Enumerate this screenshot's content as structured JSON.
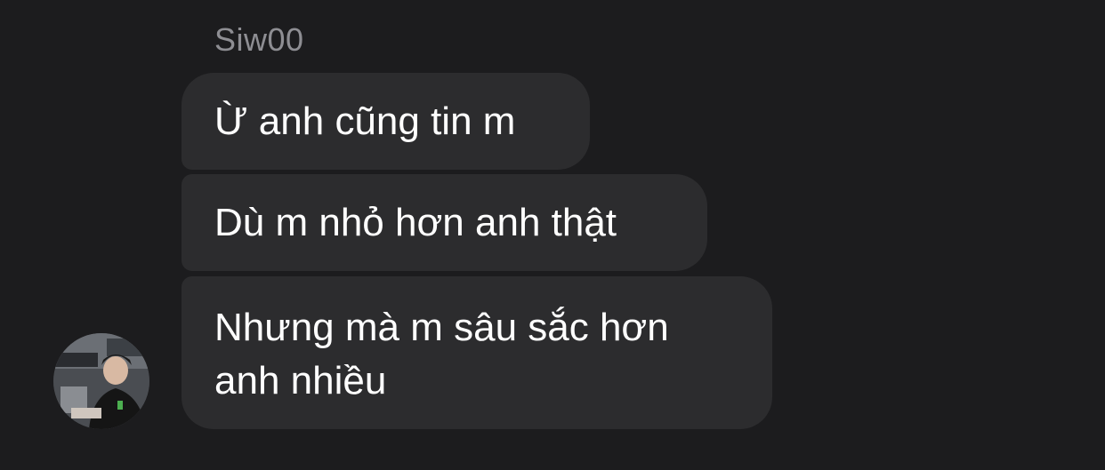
{
  "conversation": {
    "sender_name": "Siw00",
    "messages": [
      {
        "lines": [
          "Ừ anh cũng tin m"
        ]
      },
      {
        "lines": [
          "Dù m nhỏ hơn anh thật"
        ]
      },
      {
        "lines": [
          "Nhưng mà m sâu sắc hơn",
          "anh nhiều"
        ]
      }
    ]
  },
  "colors": {
    "background": "#1c1c1e",
    "bubble": "#2c2c2e",
    "text": "#ffffff",
    "sender_name": "#8e8e93"
  },
  "avatar": {
    "icon": "user-photo-avatar"
  }
}
